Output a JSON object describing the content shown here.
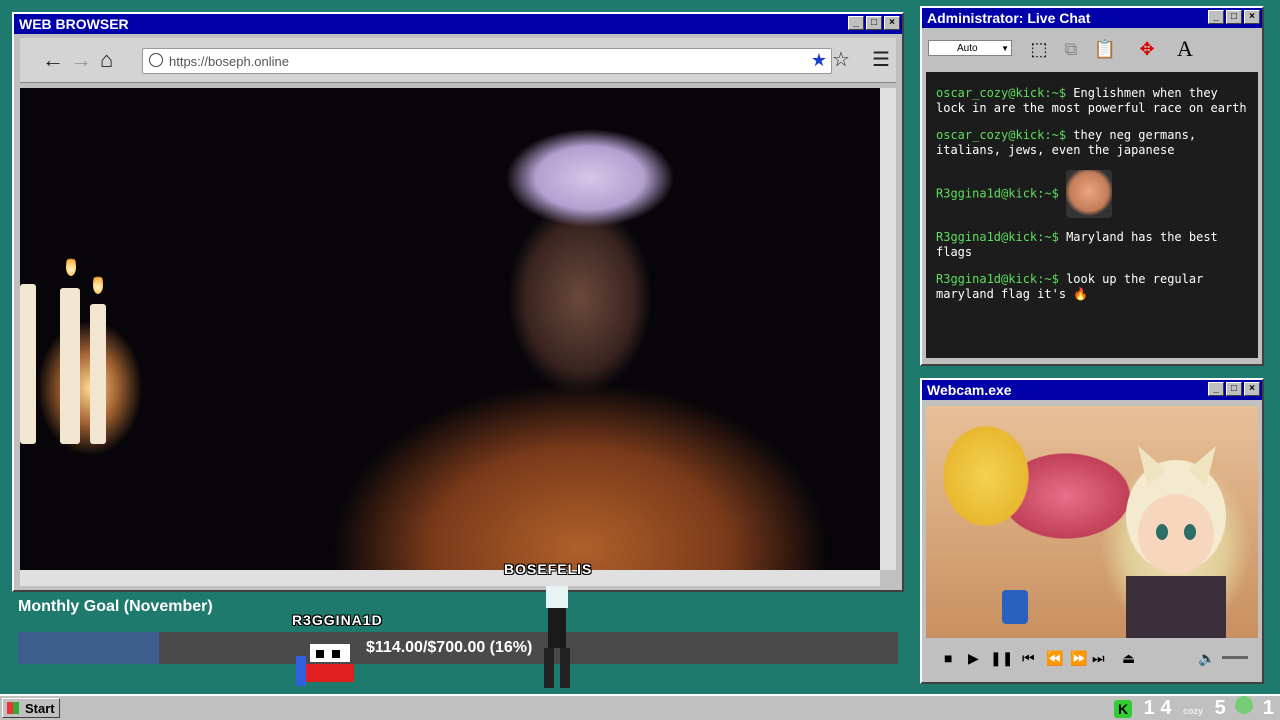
{
  "browser": {
    "title": "WEB BROWSER",
    "url": "https://boseph.online",
    "overlay_name": "BOSEFELIS"
  },
  "chat": {
    "title": "Administrator: Live Chat",
    "select_value": "Auto",
    "messages": [
      {
        "user": "oscar_cozy@kick:~$",
        "text": "Englishmen when they lock in are the most powerful race on earth"
      },
      {
        "user": "oscar_cozy@kick:~$",
        "text": "they neg germans, italians, jews, even the japanese"
      },
      {
        "user": "R3ggina1d@kick:~$",
        "text": ""
      },
      {
        "user": "R3ggina1d@kick:~$",
        "text": "Maryland has the best flags"
      },
      {
        "user": "R3ggina1d@kick:~$",
        "text": "look up the regular maryland flag it's 🔥"
      }
    ]
  },
  "webcam": {
    "title": "Webcam.exe"
  },
  "goal": {
    "title": "Monthly Goal (November)",
    "text": "$114.00/$700.00 (16%)",
    "fraction": 0.16,
    "donor_label": "R3GGINA1D"
  },
  "taskbar": {
    "start_label": "Start",
    "tray_numbers": [
      "1",
      "4",
      "5",
      "1"
    ],
    "tray_small": "cozy"
  },
  "colors": {
    "desktop": "#1e7a6c",
    "titlebar": "#0000a8",
    "chat_user": "#5dde5d",
    "goal_fill": "#3d5e8c"
  }
}
